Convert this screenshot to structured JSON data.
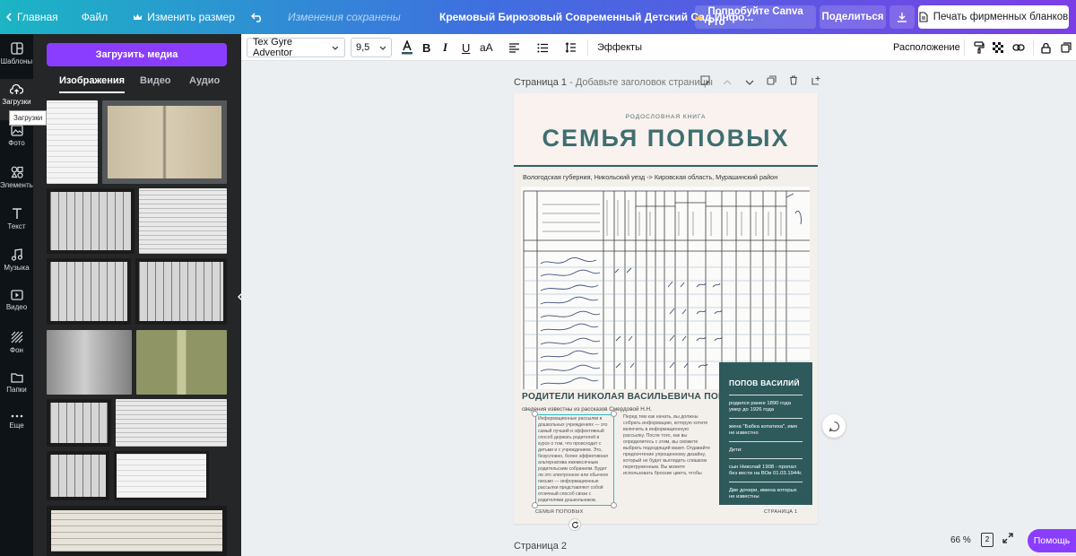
{
  "topbar": {
    "home": "Главная",
    "file": "Файл",
    "resize": "Изменить размер",
    "saved": "Изменения сохранены",
    "title": "Кремовый Бирюзовый Современный Детский Сад Инфо...",
    "try_pro": "Попробуйте Canva Pro",
    "share": "Поделиться",
    "print": "Печать фирменных бланков"
  },
  "rail": {
    "templates": "Шаблоны",
    "uploads": "Загрузки",
    "photos": "Фото",
    "elements": "Элементы",
    "text": "Текст",
    "music": "Музыка",
    "video": "Видео",
    "background": "Фон",
    "folders": "Папки",
    "more": "Еще",
    "tooltip": "Загрузки"
  },
  "panel": {
    "upload_button": "Загрузить медиа",
    "tabs": [
      "Изображения",
      "Видео",
      "Аудио"
    ]
  },
  "toolbar": {
    "font": "Tex Gyre Adventor",
    "size": "9,5",
    "effects": "Эффекты",
    "position": "Расположение"
  },
  "canvas": {
    "page1_label": "Страница 1",
    "page1_sub": "- Добавьте заголовок страницы",
    "page2_label": "Страница 2",
    "zoom": "66 %",
    "page_count": "2",
    "help": "Помощь"
  },
  "design": {
    "subtitle": "РОДОСЛОВНАЯ КНИГА",
    "title": "СЕМЬЯ ПОПОВЫХ",
    "region": "Вологодская губерния, Никольский уезд -> Кировская область, Мурашинский район",
    "parents_title": "РОДИТЕЛИ НИКОЛАЯ ВАСИЛЬЕВИЧА ПОПОВА",
    "parents_note": "сведения известны из рассказов Смердовой Н.Н.",
    "col1": "Информационные рассылки в дошкольных учреждениях — это самый лучший и эффективный способ держать родителей в курсе о том, что происходит с детьми и с учреждением. Это, безусловно, более эффективная альтернатива ежемесячным родительским собраниям. Будет ли это электронное или обычное письмо — информационные рассылки представляют собой отличный способ связи с родителями дошкольников.",
    "col2": "Перед тем как начать, вы должны собрать информацию, которую хотите включить в информационную рассылку. После того, как вы определитесь с этим, вы сможете выбрать подходящий макет. Отдавайте предпочтение упрощенному дизайну, который не будет выглядеть слишком перегруженным. Вы можете использовать броские цвета, чтобы",
    "bio_title": "ПОПОВ ВАСИЛИЙ",
    "bio_1": "родился ранее 1890 года умер до 1926 года",
    "bio_2": "жена \"Бабка копатиха\", имя не известно",
    "bio_3": "Дети:",
    "bio_4": "сын Николай 1908 - пропал без вести на ВОв 01.03.1944г.",
    "bio_5": "Две дочери, имена которых не известны",
    "footer_left": "СЕМЬЯ ПОПОВЫХ",
    "footer_right": "СТРАНИЦА 1"
  },
  "colors": {
    "accent": "#8b3dff",
    "title_teal": "#3f6e70",
    "bio_bg": "#2e5a5c"
  }
}
